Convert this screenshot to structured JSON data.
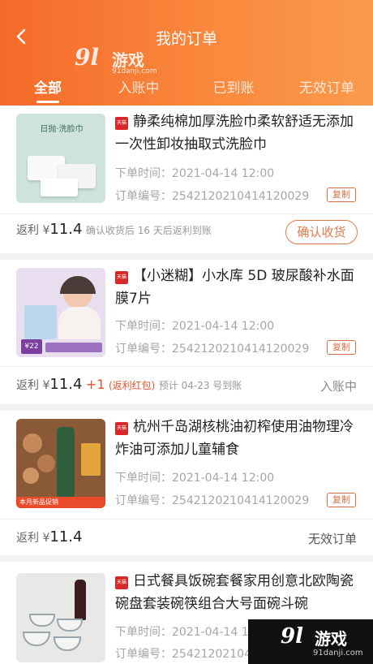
{
  "header": {
    "title": "我的订单",
    "watermark_logo": "9l",
    "watermark_cn": "游戏",
    "watermark_url": "91danji.com"
  },
  "tabs": [
    {
      "label": "全部",
      "active": true
    },
    {
      "label": "入账中",
      "active": false
    },
    {
      "label": "已到账",
      "active": false
    },
    {
      "label": "无效订单",
      "active": false
    }
  ],
  "orders": [
    {
      "store_badge": "天猫",
      "title": "静柔纯棉加厚洗脸巾柔软舒适无添加一次性卸妆抽取式洗脸巾",
      "time_label": "下单时间：",
      "time": "2021-04-14 12:00",
      "no_label": "订单编号：",
      "order_no": "2542120210414120029",
      "copy_label": "复制",
      "rebate_label": "返利",
      "currency": "¥",
      "rebate_amount": "11.4",
      "note": "确认收货后 16 天后返利到账",
      "action_label": "确认收货"
    },
    {
      "store_badge": "天猫",
      "title": "【小迷糊】小水库 5D 玻尿酸补水面膜7片",
      "time_label": "下单时间：",
      "time": "2021-04-14 12:00",
      "no_label": "订单编号：",
      "order_no": "2542120210414120029",
      "copy_label": "复制",
      "rebate_label": "返利",
      "currency": "¥",
      "rebate_amount": "11.4",
      "bonus": "+1",
      "bonus_tag": "(返利红包)",
      "note": "预计 04-23 号到账",
      "status": "入账中"
    },
    {
      "store_badge": "天猫",
      "title": "杭州千岛湖核桃油初榨使用油物理冷炸油可添加儿童辅食",
      "time_label": "下单时间：",
      "time": "2021-04-14 12:00",
      "no_label": "订单编号：",
      "order_no": "2542120210414120029",
      "copy_label": "复制",
      "rebate_label": "返利",
      "currency": "¥",
      "rebate_amount": "11.4",
      "status": "无效订单"
    },
    {
      "store_badge": "天猫",
      "title": "日式餐具饭碗套餐家用创意北欧陶瓷碗盘套装碗筷组合大号面碗斗碗",
      "time_label": "下单时间：",
      "time": "2021-04-14 12:00",
      "no_label": "订单编号：",
      "order_no": "2542120210414120029"
    }
  ],
  "thumb_texts": {
    "towel_label": "日抛·洗脸巾",
    "mask_price": "¥22",
    "oil_tag": "本月新品促销"
  },
  "bottom_watermark": {
    "logo": "9l",
    "cn": "游戏",
    "url": "91danji.com"
  },
  "colors": {
    "header_start": "#f56a2a",
    "header_end": "#fb9a4c",
    "accent": "#e07a4e",
    "badge": "#d62828"
  }
}
